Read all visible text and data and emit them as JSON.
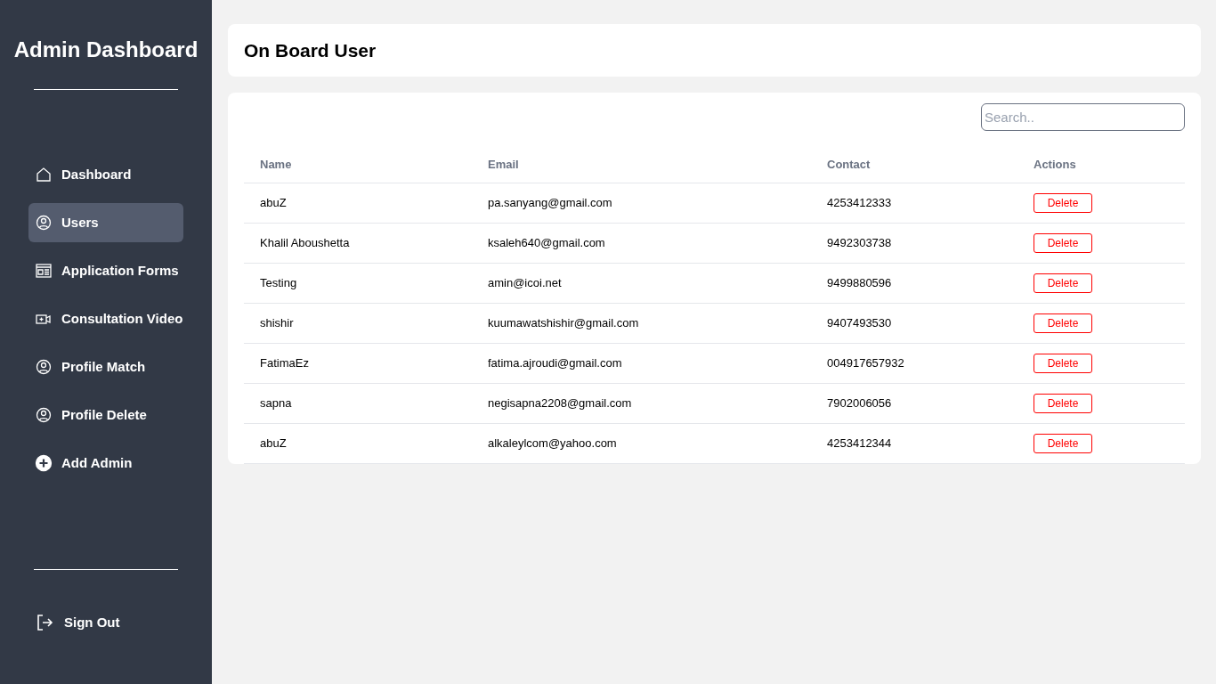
{
  "sidebar": {
    "title": "Admin Dashboard",
    "items": [
      {
        "label": "Dashboard",
        "selected": false
      },
      {
        "label": "Users",
        "selected": true
      },
      {
        "label": "Application Forms",
        "selected": false
      },
      {
        "label": "Consultation Video",
        "selected": false
      },
      {
        "label": "Profile Match",
        "selected": false
      },
      {
        "label": "Profile Delete",
        "selected": false
      },
      {
        "label": "Add Admin",
        "selected": false
      }
    ],
    "sign_out": "Sign Out"
  },
  "header": {
    "title": "On Board User"
  },
  "search": {
    "placeholder": "Search.."
  },
  "table": {
    "columns": [
      "Name",
      "Email",
      "Contact",
      "Actions"
    ],
    "rows": [
      {
        "name": "abuZ",
        "email": "pa.sanyang@gmail.com",
        "contact": "4253412333",
        "action": "Delete"
      },
      {
        "name": "Khalil Aboushetta",
        "email": "ksaleh640@gmail.com",
        "contact": "9492303738",
        "action": "Delete"
      },
      {
        "name": "Testing",
        "email": "amin@icoi.net",
        "contact": "9499880596",
        "action": "Delete"
      },
      {
        "name": "shishir",
        "email": "kuumawatshishir@gmail.com",
        "contact": "9407493530",
        "action": "Delete"
      },
      {
        "name": "FatimaEz",
        "email": "fatima.ajroudi@gmail.com",
        "contact": "004917657932",
        "action": "Delete"
      },
      {
        "name": "sapna",
        "email": "negisapna2208@gmail.com",
        "contact": "7902006056",
        "action": "Delete"
      },
      {
        "name": "abuZ",
        "email": "alkaleylcom@yahoo.com",
        "contact": "4253412344",
        "action": "Delete"
      }
    ]
  }
}
